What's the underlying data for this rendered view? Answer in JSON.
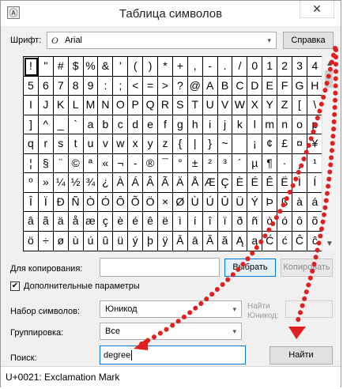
{
  "window": {
    "title": "Таблица символов",
    "close_glyph": "✕",
    "icon_glyph": "Ⓐ"
  },
  "font": {
    "label": "Шрифт:",
    "value": "Arial",
    "glyph": "O",
    "help_button": "Справка"
  },
  "grid": {
    "selected_index": 0,
    "rows": [
      [
        "!",
        "\"",
        "#",
        "$",
        "%",
        "&",
        "'",
        "(",
        ")",
        "*",
        "+",
        ",",
        "-",
        ".",
        "/",
        "0",
        "1",
        "2",
        "3",
        "4"
      ],
      [
        "5",
        "6",
        "7",
        "8",
        "9",
        ":",
        ";",
        "<",
        "=",
        ">",
        "?",
        "@",
        "A",
        "B",
        "C",
        "D",
        "E",
        "F",
        "G",
        "H"
      ],
      [
        "I",
        "J",
        "K",
        "L",
        "M",
        "N",
        "O",
        "P",
        "Q",
        "R",
        "S",
        "T",
        "U",
        "V",
        "W",
        "X",
        "Y",
        "Z",
        "[",
        "\\"
      ],
      [
        "]",
        "^",
        "_",
        "`",
        "a",
        "b",
        "c",
        "d",
        "e",
        "f",
        "g",
        "h",
        "i",
        "j",
        "k",
        "l",
        "m",
        "n",
        "o",
        "p"
      ],
      [
        "q",
        "r",
        "s",
        "t",
        "u",
        "v",
        "w",
        "x",
        "y",
        "z",
        "{",
        "|",
        "}",
        "~",
        " ",
        "¡",
        "¢",
        "£",
        "¤",
        "¥"
      ],
      [
        "¦",
        "§",
        "¨",
        "©",
        "ª",
        "«",
        "¬",
        "-",
        "®",
        "¯",
        "°",
        "±",
        "²",
        "³",
        "´",
        "µ",
        "¶",
        "·",
        "¸",
        "¹"
      ],
      [
        "º",
        "»",
        "¼",
        "½",
        "¾",
        "¿",
        "À",
        "Á",
        "Â",
        "Ã",
        "Ä",
        "Å",
        "Æ",
        "Ç",
        "È",
        "É",
        "Ê",
        "Ë",
        "Ì",
        "Í"
      ],
      [
        "Î",
        "Ï",
        "Ð",
        "Ñ",
        "Ò",
        "Ó",
        "Ô",
        "Õ",
        "Ö",
        "×",
        "Ø",
        "Ù",
        "Ú",
        "Û",
        "Ü",
        "Ý",
        "Þ",
        "ß",
        "à",
        "á"
      ],
      [
        "â",
        "ã",
        "ä",
        "å",
        "æ",
        "ç",
        "è",
        "é",
        "ê",
        "ë",
        "ì",
        "í",
        "î",
        "ï",
        "ð",
        "ñ",
        "ò",
        "ó",
        "ô",
        "õ"
      ],
      [
        "ö",
        "÷",
        "ø",
        "ù",
        "ú",
        "û",
        "ü",
        "ý",
        "þ",
        "ÿ",
        "Ā",
        "ā",
        "Ă",
        "ă",
        "Ą",
        "ą",
        "Ć",
        "ć",
        "Ĉ",
        "ĉ"
      ]
    ]
  },
  "scrollbar": {
    "up_glyph": "▲",
    "down_glyph": "▼"
  },
  "copy": {
    "label": "Для копирования:",
    "value": "",
    "select_button": "Выбрать",
    "copy_button": "Копировать"
  },
  "advanced": {
    "label": "Дополнительные параметры",
    "checked": true,
    "check_glyph": "✔"
  },
  "charset": {
    "label": "Набор символов:",
    "value": "Юникод",
    "goto_label": "Найти Юникод:"
  },
  "grouping": {
    "label": "Группировка:",
    "value": "Все"
  },
  "search": {
    "label": "Поиск:",
    "value": "degree",
    "button": "Найти"
  },
  "status": {
    "text": "U+0021: Exclamation Mark"
  },
  "dropdown_arrow": "▾",
  "annotation_color": "#e02020"
}
